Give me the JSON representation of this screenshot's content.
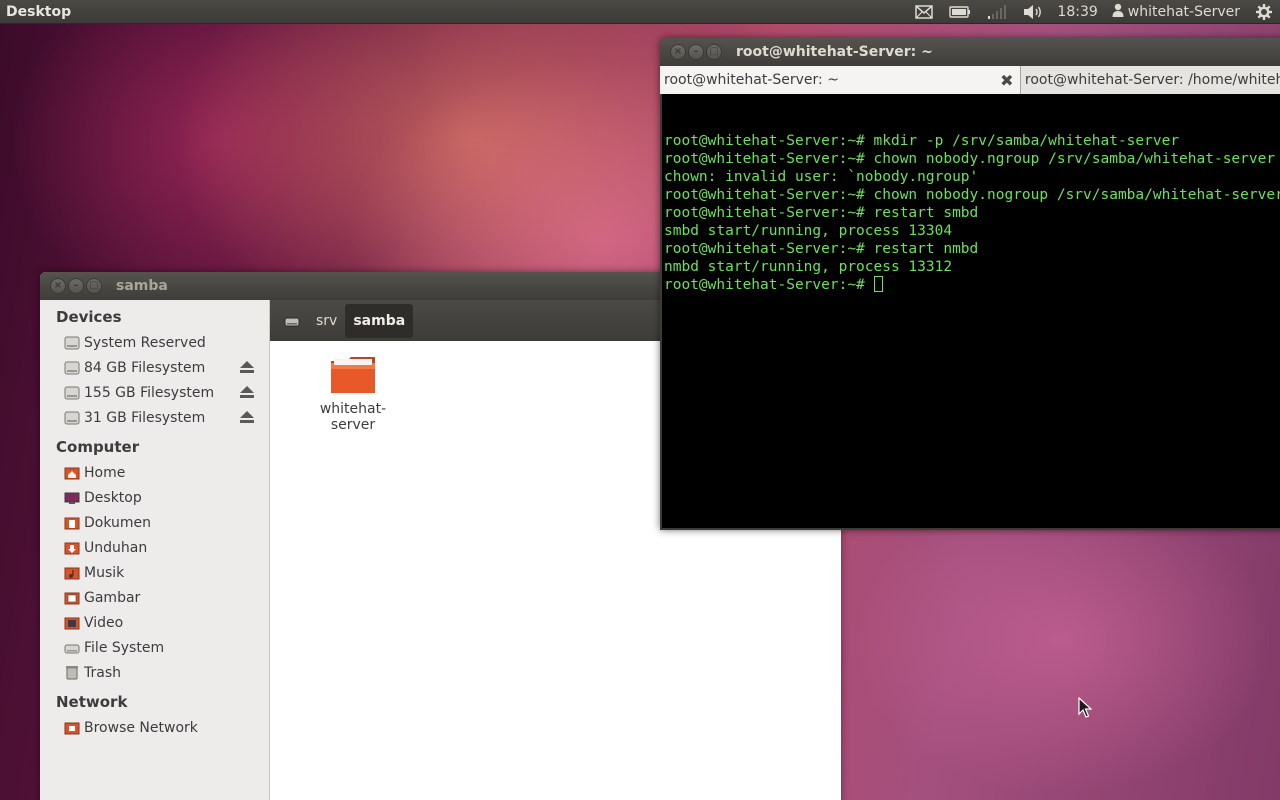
{
  "panel": {
    "title": "Desktop",
    "clock": "18:39",
    "user": "whitehat-Server",
    "icons": [
      "mail-icon",
      "battery-icon",
      "network-signal-icon",
      "volume-icon",
      "user-icon",
      "gear-icon"
    ]
  },
  "file_manager": {
    "title": "samba",
    "sections": {
      "devices": "Devices",
      "computer": "Computer",
      "network": "Network"
    },
    "devices": [
      {
        "label": "System Reserved",
        "icon": "drive-icon",
        "eject": false
      },
      {
        "label": "84 GB Filesystem",
        "icon": "drive-icon",
        "eject": true
      },
      {
        "label": "155 GB Filesystem",
        "icon": "drive-icon",
        "eject": true
      },
      {
        "label": "31 GB Filesystem",
        "icon": "drive-icon",
        "eject": true
      }
    ],
    "computer": [
      {
        "label": "Home",
        "icon": "home-folder-icon"
      },
      {
        "label": "Desktop",
        "icon": "desktop-icon"
      },
      {
        "label": "Dokumen",
        "icon": "documents-folder-icon"
      },
      {
        "label": "Unduhan",
        "icon": "downloads-folder-icon"
      },
      {
        "label": "Musik",
        "icon": "music-folder-icon"
      },
      {
        "label": "Gambar",
        "icon": "pictures-folder-icon"
      },
      {
        "label": "Video",
        "icon": "videos-folder-icon"
      },
      {
        "label": "File System",
        "icon": "filesystem-icon"
      },
      {
        "label": "Trash",
        "icon": "trash-icon"
      }
    ],
    "network": [
      {
        "label": "Browse Network",
        "icon": "network-folder-icon"
      }
    ],
    "breadcrumbs": [
      "srv",
      "samba"
    ],
    "items": [
      {
        "name": "whitehat-server",
        "icon": "folder-icon"
      }
    ]
  },
  "terminal": {
    "title": "root@whitehat-Server: ~",
    "tabs": [
      {
        "label": "root@whitehat-Server: ~",
        "active": true
      },
      {
        "label": "root@whitehat-Server: /home/whitehat",
        "active": false
      }
    ],
    "lines": [
      "root@whitehat-Server:~# mkdir -p /srv/samba/whitehat-server",
      "root@whitehat-Server:~# chown nobody.ngroup /srv/samba/whitehat-server",
      "chown: invalid user: `nobody.ngroup'",
      "root@whitehat-Server:~# chown nobody.nogroup /srv/samba/whitehat-server",
      "root@whitehat-Server:~# restart smbd",
      "smbd start/running, process 13304",
      "root@whitehat-Server:~# restart nmbd",
      "nmbd start/running, process 13312"
    ],
    "prompt": "root@whitehat-Server:~# "
  },
  "colors": {
    "terminal_text": "#6de05c",
    "panel_bg": "#3c3b37",
    "folder_orange": "#e8592a"
  }
}
